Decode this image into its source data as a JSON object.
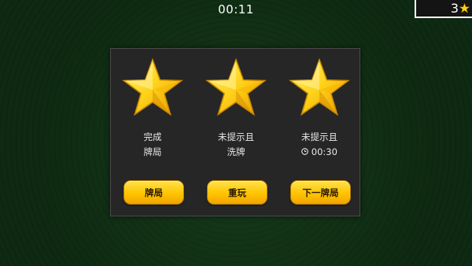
{
  "header": {
    "timer": "00:11",
    "star_count": "3",
    "star_icon": "star-icon"
  },
  "panel": {
    "columns": [
      {
        "caption_lines": [
          "完成",
          "牌局"
        ],
        "button_label": "牌局",
        "star_earned": true
      },
      {
        "caption_lines": [
          "未提示且",
          "洗牌"
        ],
        "button_label": "重玩",
        "star_earned": true
      },
      {
        "caption_lines": [
          "未提示且"
        ],
        "clock_time": "00:30",
        "clock_icon": "clock-icon",
        "button_label": "下一牌局",
        "star_earned": true
      }
    ]
  },
  "colors": {
    "background": "#0e2a12",
    "panel": "#262626",
    "star": "#ffd21a",
    "button": "#ffc400",
    "text": "#e8e8e8"
  }
}
